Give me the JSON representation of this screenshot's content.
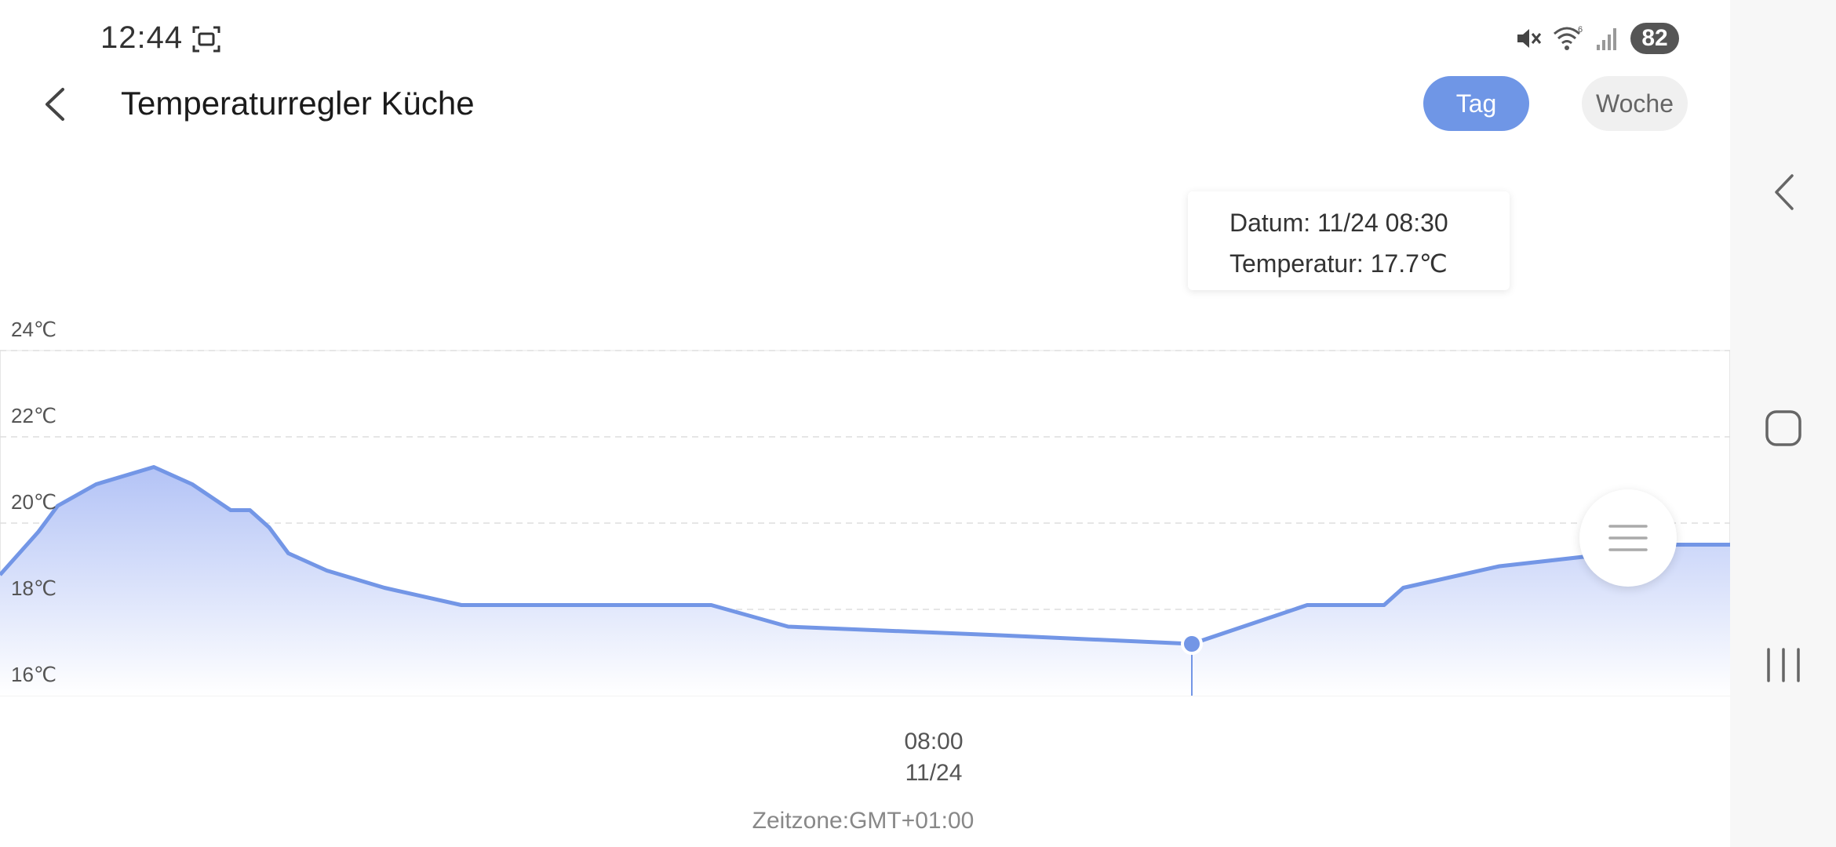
{
  "status_bar": {
    "time": "12:44",
    "battery": "82",
    "icons": [
      "screenshot-icon",
      "mute-icon",
      "wifi-icon",
      "signal-icon"
    ]
  },
  "header": {
    "title": "Temperaturregler Küche",
    "tabs": [
      {
        "label": "Tag",
        "active": true
      },
      {
        "label": "Woche",
        "active": false
      }
    ]
  },
  "tooltip": {
    "date_line": "Datum: 11/24 08:30",
    "temp_line": "Temperatur: 17.7℃"
  },
  "chart_data": {
    "type": "area",
    "y_tick_labels": [
      "24℃",
      "22℃",
      "20℃",
      "18℃",
      "16℃"
    ],
    "ylim": [
      16,
      24
    ],
    "x_tick_label_time": "08:00",
    "x_tick_label_date": "11/24",
    "grid": true,
    "color": "#7396e6",
    "fill_top_color": "#b3c3f6",
    "fill_bottom_color": "#ffffff",
    "series": [
      {
        "x": [
          "07:28",
          "07:30",
          "07:31",
          "07:33",
          "07:36",
          "07:38",
          "07:40",
          "07:41",
          "07:42",
          "07:43",
          "07:45",
          "07:48",
          "07:52",
          "07:58",
          "08:05",
          "08:09",
          "08:20",
          "08:30",
          "08:36",
          "08:40",
          "08:41",
          "08:46",
          "08:52",
          "08:55",
          "08:58"
        ],
        "values": [
          18.8,
          19.8,
          20.4,
          20.9,
          21.3,
          20.9,
          20.3,
          20.3,
          19.9,
          19.3,
          18.9,
          18.5,
          18.1,
          18.1,
          18.1,
          17.6,
          17.4,
          17.2,
          18.1,
          18.1,
          18.5,
          19.0,
          19.3,
          19.5,
          19.5
        ]
      }
    ],
    "selected_point": {
      "x": "08:30",
      "value": 17.7
    }
  },
  "footer": {
    "timezone": "Zeitzone:GMT+01:00"
  }
}
